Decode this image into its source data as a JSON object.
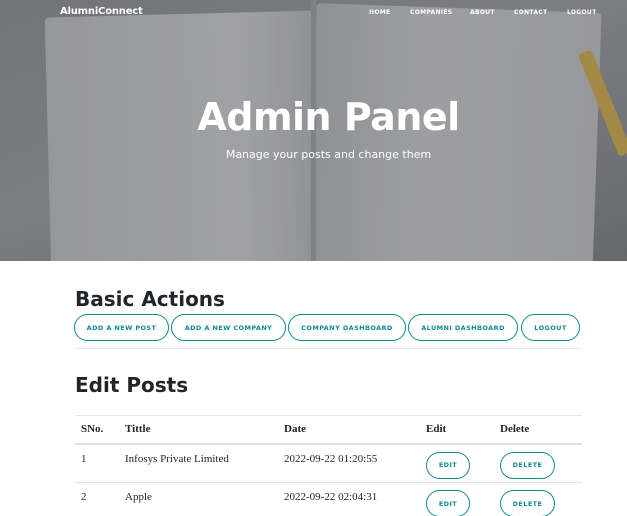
{
  "nav": {
    "brand": "AlumniConnect",
    "links": [
      "HOME",
      "COMPANIES",
      "ABOUT",
      "CONTACT",
      "LOGOUT"
    ]
  },
  "hero": {
    "title": "Admin Panel",
    "subtitle": "Manage your posts and change them"
  },
  "basic_actions": {
    "heading": "Basic Actions",
    "buttons": [
      "ADD A NEW POST",
      "ADD A NEW COMPANY",
      "COMPANY DASHBOARD",
      "ALUMNI DASHBOARD",
      "LOGOUT"
    ]
  },
  "edit_posts": {
    "heading": "Edit Posts",
    "columns": [
      "SNo.",
      "Tittle",
      "Date",
      "Edit",
      "Delete"
    ],
    "rows": [
      {
        "sno": "1",
        "title": "Infosys Private Limited",
        "date": "2022-09-22 01:20:55",
        "edit": "EDIT",
        "delete": "DELETE"
      },
      {
        "sno": "2",
        "title": "Apple",
        "date": "2022-09-22 02:04:31",
        "edit": "EDIT",
        "delete": "DELETE"
      }
    ]
  },
  "colors": {
    "accent": "#0d8a8f",
    "text": "#212529"
  }
}
